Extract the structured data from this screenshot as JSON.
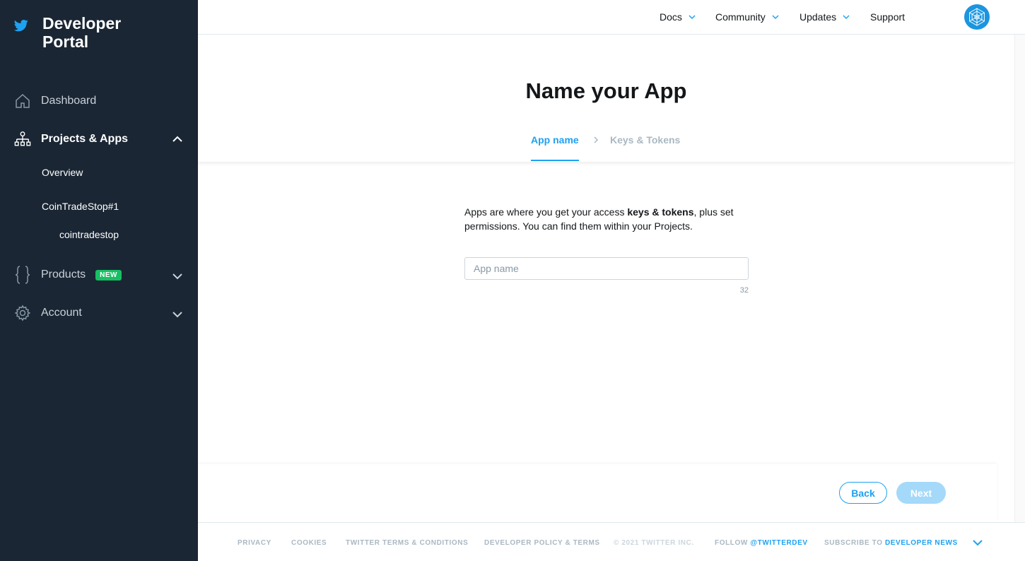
{
  "brand": {
    "title": "Developer Portal"
  },
  "sidebar": {
    "dashboard": "Dashboard",
    "projects_apps": "Projects & Apps",
    "overview": "Overview",
    "project": "CoinTradeStop#1",
    "app": "cointradestop",
    "products": "Products",
    "products_badge": "NEW",
    "account": "Account"
  },
  "topnav": {
    "docs": "Docs",
    "community": "Community",
    "updates": "Updates",
    "support": "Support"
  },
  "main": {
    "title": "Name your App",
    "steps": [
      "App name",
      "Keys & Tokens"
    ],
    "desc_pre": "Apps are where you get your access ",
    "desc_bold": "keys & tokens",
    "desc_post": ", plus set permissions. You can find them within your Projects.",
    "input_placeholder": "App name",
    "input_value": "",
    "char_counter": "32"
  },
  "actions": {
    "back": "Back",
    "next": "Next"
  },
  "footer": {
    "privacy": "PRIVACY",
    "cookies": "COOKIES",
    "terms": "TWITTER TERMS & CONDITIONS",
    "policy": "DEVELOPER POLICY & TERMS",
    "copyright": "© 2021 TWITTER INC.",
    "follow_pre": "FOLLOW ",
    "follow_handle": "@TWITTERDEV",
    "subscribe_pre": "SUBSCRIBE TO ",
    "subscribe_link": "DEVELOPER NEWS"
  },
  "colors": {
    "sidebar_bg": "#1a2634",
    "accent": "#1da1f2",
    "badge_green": "#17bf63",
    "next_disabled": "#a4d9f9"
  }
}
